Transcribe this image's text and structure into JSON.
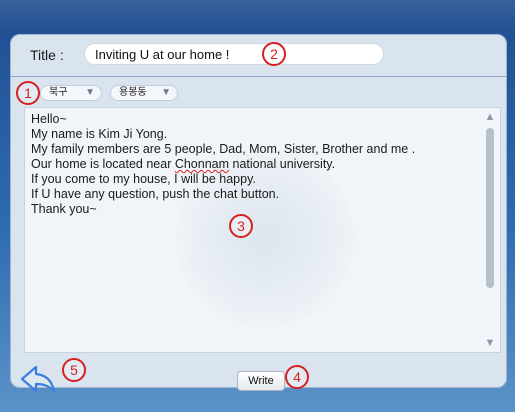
{
  "compose": {
    "title_label": "Title :",
    "title_value": "Inviting U at our home !",
    "district_dropdown": "북구",
    "neighborhood_dropdown": "용봉동",
    "body_lines": [
      "Hello~",
      "My name is Kim Ji Yong.",
      "My family members are 5 people, Dad, Mom, Sister, Brother and me .",
      "Our home is located near ",
      "Chonnam",
      " national university.",
      "If you come to my house, I will be happy.",
      "If U have any question, push the chat button.",
      "Thank you~"
    ],
    "write_button": "Write"
  },
  "annotations": {
    "marker_1": "1",
    "marker_2": "2",
    "marker_3": "3",
    "marker_4": "4",
    "marker_5": "5",
    "color": "#d62020"
  },
  "icons": {
    "back": "back-arrow-icon",
    "dropdown_arrow": "triangle-down-icon",
    "scroll_up": "triangle-up-icon",
    "scroll_down": "triangle-down-icon"
  },
  "colors": {
    "background_blue": "#2e6bb0",
    "panel": "#d9e4ef",
    "back_icon": "#3a7ee0"
  }
}
